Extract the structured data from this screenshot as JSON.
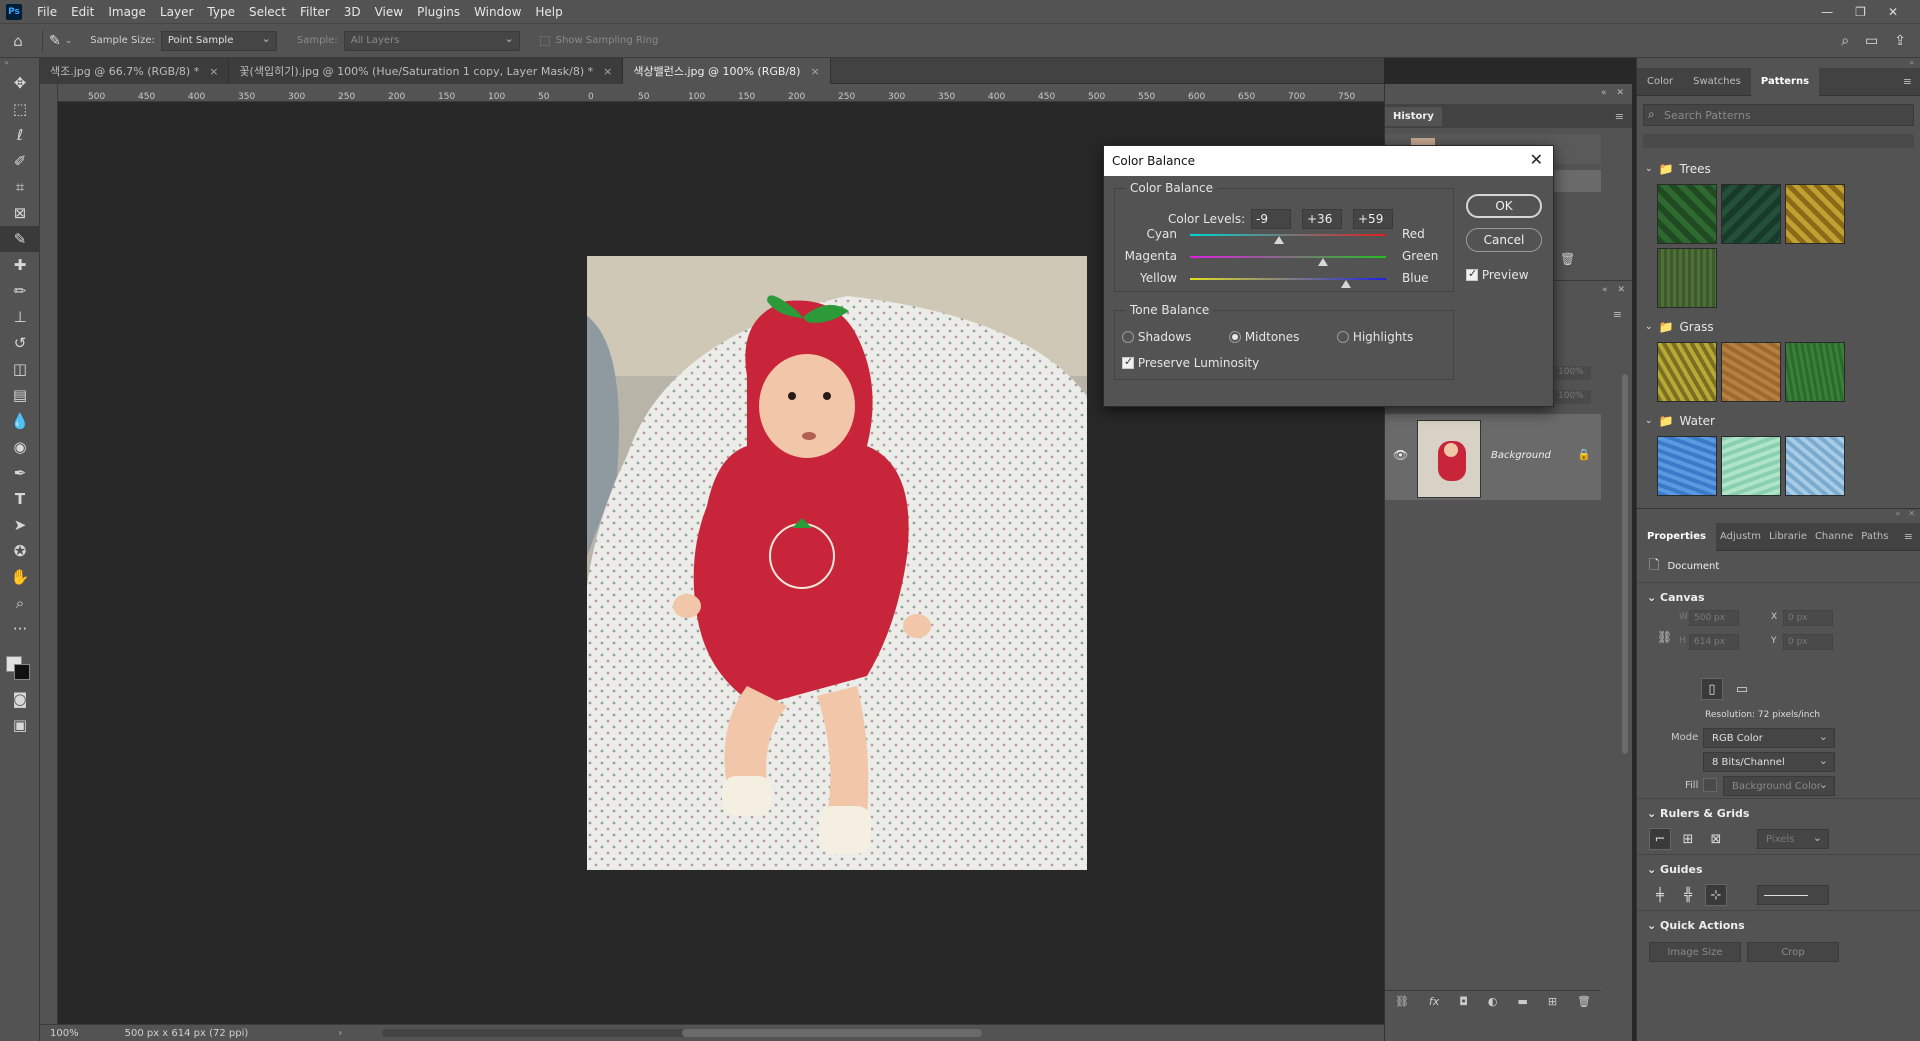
{
  "menubar": {
    "logo": "Ps",
    "items": [
      "File",
      "Edit",
      "Image",
      "Layer",
      "Type",
      "Select",
      "Filter",
      "3D",
      "View",
      "Plugins",
      "Window",
      "Help"
    ]
  },
  "options": {
    "sample_size_label": "Sample Size:",
    "sample_size_value": "Point Sample",
    "sample_label": "Sample:",
    "sample_value": "All Layers",
    "sampling_ring_label": "Show Sampling Ring"
  },
  "tabs": [
    {
      "label": "색조.jpg @ 66.7% (RGB/8) *",
      "active": false
    },
    {
      "label": "꽃(색입히기).jpg @ 100% (Hue/Saturation 1 copy, Layer Mask/8) *",
      "active": false
    },
    {
      "label": "색상밸런스.jpg @ 100% (RGB/8)",
      "active": true
    }
  ],
  "ruler_ticks": [
    "500",
    "450",
    "400",
    "350",
    "300",
    "250",
    "200",
    "150",
    "100",
    "50",
    "0",
    "50",
    "100",
    "150",
    "200",
    "250",
    "300",
    "350",
    "400",
    "450",
    "500",
    "550",
    "600",
    "650",
    "700",
    "750"
  ],
  "status": {
    "zoom": "100%",
    "doc_info": "500 px x 614 px (72 ppi)"
  },
  "history_panel": {
    "tab": "History"
  },
  "layers": {
    "background_label": "Background",
    "opacity": "100%",
    "fill": "100%"
  },
  "right_panel": {
    "tabs": [
      "Color",
      "Swatches",
      "Patterns"
    ],
    "active_tab": "Patterns",
    "search_placeholder": "Search Patterns",
    "groups": [
      {
        "name": "Trees",
        "swatches": [
          "#1f4a22",
          "#173a2c",
          "#8a6a18",
          "#3c5a2c"
        ]
      },
      {
        "name": "Grass",
        "swatches": [
          "#7a7020",
          "#9a6a30",
          "#2a6a2a"
        ]
      },
      {
        "name": "Water",
        "swatches": [
          "#3a7ac8",
          "#8ad0b0",
          "#7aaad0"
        ]
      }
    ]
  },
  "properties": {
    "tabs": [
      "Properties",
      "Adjustm",
      "Librarie",
      "Channe",
      "Paths"
    ],
    "doc_label": "Document",
    "canvas_title": "Canvas",
    "w_label": "W",
    "w_value": "500 px",
    "h_label": "H",
    "h_value": "614 px",
    "x_label": "X",
    "x_value": "0 px",
    "y_label": "Y",
    "y_value": "0 px",
    "resolution": "Resolution: 72 pixels/inch",
    "mode_label": "Mode",
    "mode_value": "RGB Color",
    "bits_value": "8 Bits/Channel",
    "fill_label": "Fill",
    "fill_value": "Background Color",
    "rulers_title": "Rulers & Grids",
    "units_value": "Pixels",
    "guides_title": "Guides",
    "quick_title": "Quick Actions",
    "image_size_btn": "Image Size",
    "crop_btn": "Crop"
  },
  "dialog": {
    "title": "Color Balance",
    "group_title": "Color Balance",
    "levels_label": "Color Levels:",
    "level1": "-9",
    "level2": "+36",
    "level3": "+59",
    "sliders": [
      {
        "left": "Cyan",
        "right": "Red",
        "value": -9,
        "colors": [
          "#00d4d4",
          "#e02020"
        ]
      },
      {
        "left": "Magenta",
        "right": "Green",
        "value": 36,
        "colors": [
          "#e020e0",
          "#20c020"
        ]
      },
      {
        "left": "Yellow",
        "right": "Blue",
        "value": 59,
        "colors": [
          "#e0e020",
          "#2020e0"
        ]
      }
    ],
    "tone_title": "Tone Balance",
    "shadows": "Shadows",
    "midtones": "Midtones",
    "highlights": "Highlights",
    "preserve": "Preserve Luminosity",
    "ok": "OK",
    "cancel": "Cancel",
    "preview": "Preview"
  }
}
